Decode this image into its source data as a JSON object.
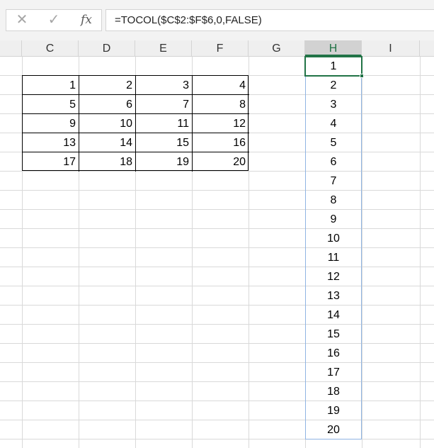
{
  "formula_bar": {
    "cancel_icon": "close-icon",
    "enter_icon": "check-icon",
    "fx_label": "fx",
    "formula": "=TOCOL($C$2:$F$6,0,FALSE)"
  },
  "columns": [
    "C",
    "D",
    "E",
    "F",
    "G",
    "H",
    "I"
  ],
  "selected_column": "H",
  "source_table": [
    [
      "1",
      "2",
      "3",
      "4"
    ],
    [
      "5",
      "6",
      "7",
      "8"
    ],
    [
      "9",
      "10",
      "11",
      "12"
    ],
    [
      "13",
      "14",
      "15",
      "16"
    ],
    [
      "17",
      "18",
      "19",
      "20"
    ]
  ],
  "result_column": [
    "1",
    "2",
    "3",
    "4",
    "5",
    "6",
    "7",
    "8",
    "9",
    "10",
    "11",
    "12",
    "13",
    "14",
    "15",
    "16",
    "17",
    "18",
    "19",
    "20"
  ],
  "colors": {
    "accent": "#217346",
    "spill_border": "#8fb4e3",
    "gridline": "#d9d9d9"
  }
}
